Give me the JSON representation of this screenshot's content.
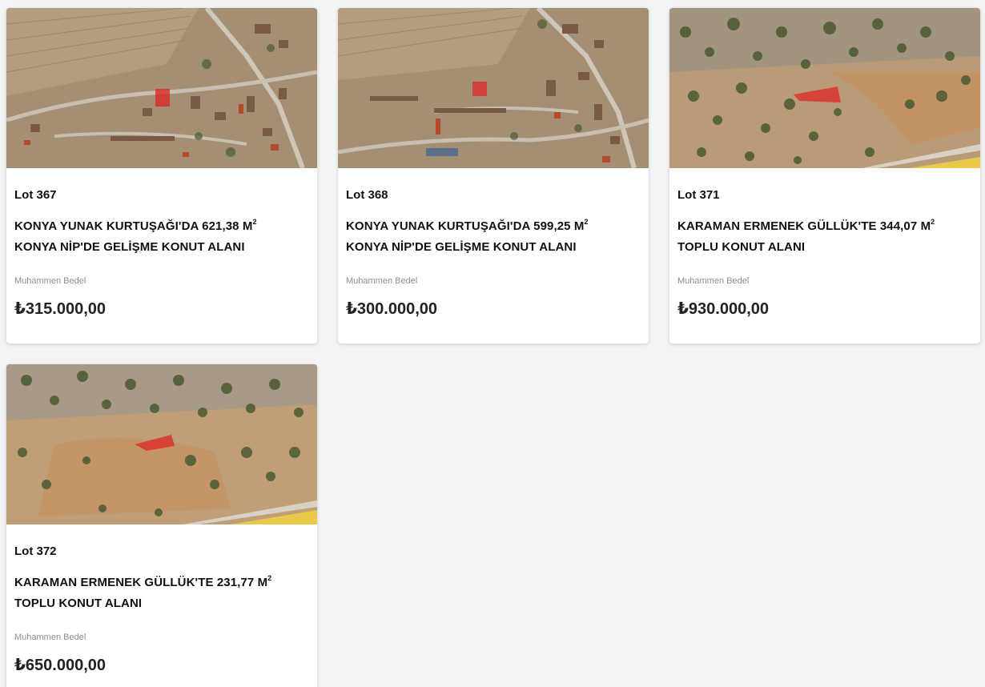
{
  "lots": [
    {
      "lot": "Lot 367",
      "title_line1": "KONYA YUNAK KURTUŞAĞI'DA 621,38 M",
      "title_sup": "2",
      "title_line2": "KONYA NİP'DE GELİŞME KONUT ALANI",
      "price_label": "Muhammen Bedel",
      "price": "₺315.000,00",
      "image": "village-aerial-map"
    },
    {
      "lot": "Lot 368",
      "title_line1": "KONYA YUNAK KURTUŞAĞI'DA 599,25 M",
      "title_sup": "2",
      "title_line2": "KONYA NİP'DE GELİŞME KONUT ALANI",
      "price_label": "Muhammen Bedel",
      "price": "₺300.000,00",
      "image": "village-aerial-map"
    },
    {
      "lot": "Lot 371",
      "title_line1": "KARAMAN ERMENEK GÜLLÜK'TE 344,07 M",
      "title_sup": "2",
      "title_line2": "TOPLU KONUT ALANI",
      "price_label": "Muhammen Bedel",
      "price": "₺930.000,00",
      "image": "terrain-aerial-map"
    },
    {
      "lot": "Lot 372",
      "title_line1": "KARAMAN ERMENEK GÜLLÜK'TE 231,77 M",
      "title_sup": "2",
      "title_line2": "TOPLU KONUT ALANI",
      "price_label": "Muhammen Bedel",
      "price": "₺650.000,00",
      "image": "terrain-aerial-map"
    }
  ],
  "colors": {
    "page_bg": "#f4f4f4",
    "card_bg": "#ffffff",
    "parcel_highlight": "#e02020",
    "label_gray": "#8a8f96"
  }
}
